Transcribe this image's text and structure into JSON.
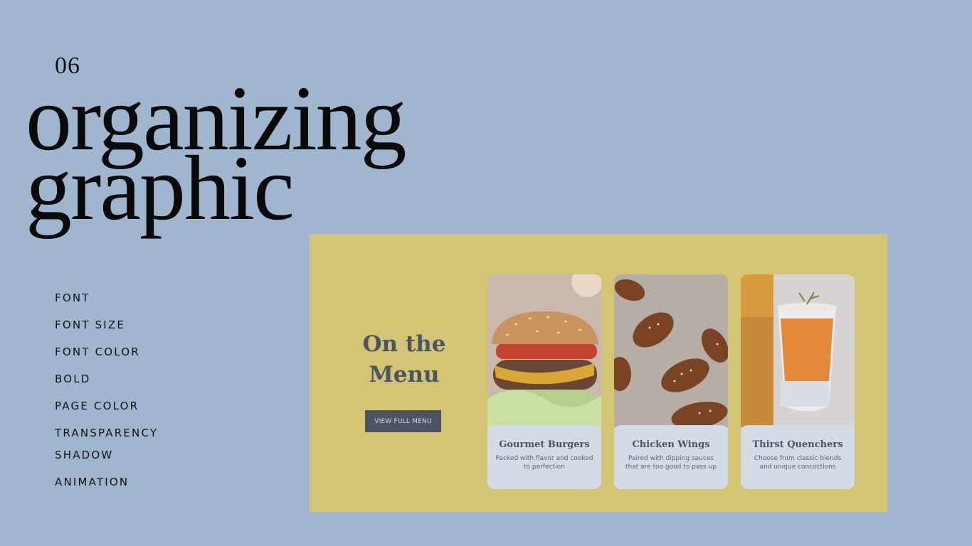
{
  "slide": {
    "number": "06",
    "title_line1": "organizing",
    "title_line2": "graphic"
  },
  "topics": [
    "FONT",
    "FONT SIZE",
    "FONT COLOR",
    "BOLD",
    "PAGE COLOR",
    "TRANSPARENCY",
    "SHADOW",
    "ANIMATION"
  ],
  "mockup": {
    "background_color": "#d4c476",
    "heading": "On the Menu",
    "button_label": "VIEW FULL MENU",
    "cards": [
      {
        "title": "Gourmet Burgers",
        "description": "Packed with flavor and cooked to perfection",
        "icon": "burger-photo"
      },
      {
        "title": "Chicken Wings",
        "description": "Paired with dipping sauces that are too good to pass up",
        "icon": "wings-photo"
      },
      {
        "title": "Thirst Quenchers",
        "description": "Choose from classic blends and unique concoctions",
        "icon": "drink-photo"
      }
    ]
  },
  "colors": {
    "page_background": "#a0b6cf",
    "text_dark": "#0a0a0a",
    "accent_slate": "#4b5565",
    "card_background": "#d3dbe6"
  }
}
